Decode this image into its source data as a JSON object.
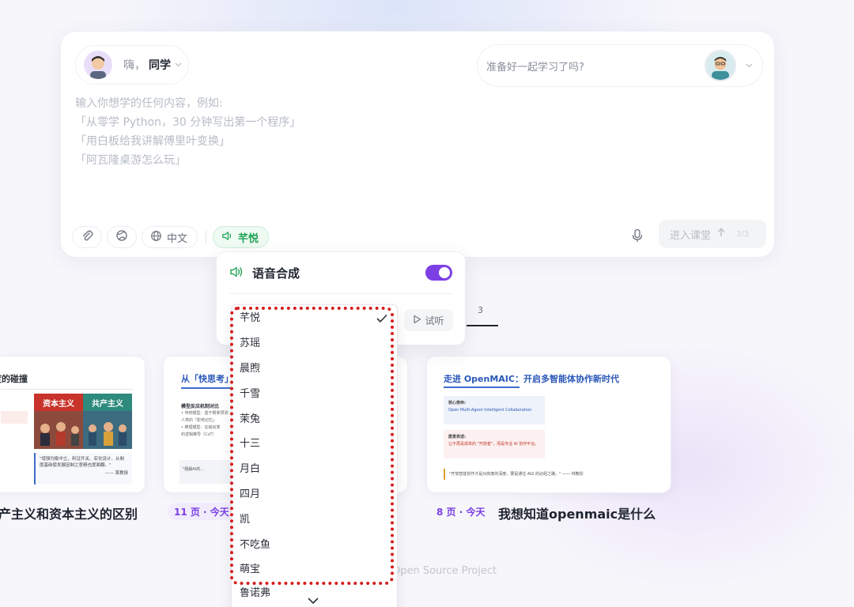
{
  "user": {
    "greeting": "嗨，",
    "name": "同学"
  },
  "assistant": {
    "prompt": "准备好一起学习了吗?"
  },
  "input": {
    "placeholder_lines": [
      "输入你想学的任何内容，例如:",
      "「从零学 Python，30 分钟写出第一个程序」",
      "「用白板给我讲解傅里叶变换」",
      "「阿瓦隆桌游怎么玩」"
    ]
  },
  "toolbar": {
    "language_label": "中文",
    "voice_label": "芊悦",
    "enter_label": "进入课堂",
    "enter_count": "3/3"
  },
  "voice_panel": {
    "title": "语音合成",
    "enabled": true,
    "try_label": "试听",
    "selected_voice": "芊悦",
    "voices": [
      "芊悦",
      "苏瑶",
      "晨煦",
      "千雪",
      "茉兔",
      "十三",
      "月白",
      "四月",
      "凯",
      "不吃鱼",
      "萌宝",
      "鲁诺弗"
    ]
  },
  "pager": {
    "page3": "3"
  },
  "cards": [
    {
      "slide_title": "度的碰撞",
      "tags": [
        "资本主义",
        "共产主义"
      ],
      "quote": "\"增强均衡中立，利证开关、宏化设计、从制度基础使发展因制之意精也度面翻。\"",
      "quote_author": "—— 某教授",
      "name": "产主义和资本主义的区别"
    },
    {
      "slide_title": "从「快思考」",
      "subtitle": "模型反应机制对比",
      "lines": [
        "• 传统模型：基于概率预测",
        "人类的「影响记忆」",
        "• 推理模型：在输出答",
        "的逻辑推导（CoT）"
      ],
      "box_text": "\"题解AI的...",
      "pages": "11 页 · 今天"
    },
    {
      "slide_title": "走进 OpenMAIC：开启多智能体协作新时代",
      "box1_head": "核心使命:",
      "box1_text": "Open Multi-Agent Intelligent Collaboration",
      "box2_head": "愿景表述:",
      "box2_text": "让不再是孤单的 \"开放者\"，而是专业 AI 协作平台。",
      "quote": "\"开放智能协作才是对高度的深度，要是通往 AGI 的必经之路。\" —— 林教授",
      "pages": "8 页 · 今天",
      "name": "我想知道openmaic是什么"
    }
  ],
  "footer": {
    "text": "Open Source Project"
  },
  "colors": {
    "accent": "#7b3fe4",
    "voice_green": "#1fa257",
    "highlight": "#d41d1d",
    "slide_blue": "#2a57b8"
  }
}
